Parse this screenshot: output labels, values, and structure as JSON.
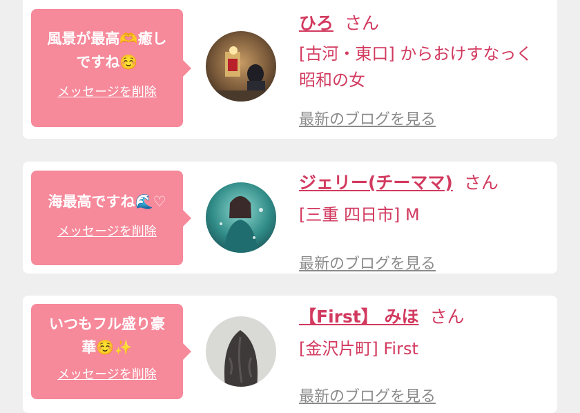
{
  "colors": {
    "bubble_bg": "#f6899a",
    "accent": "#d23a5f",
    "muted_link": "#8a8a8a",
    "page_bg": "#efefef"
  },
  "messages": [
    {
      "message": "風景が最高🫶癒し\nですね☺️",
      "delete_label": "メッセージを削除",
      "avatar": "photo-avatar-sign-and-person",
      "name": "ひろ",
      "honorific": "さん",
      "area": "[古河・東口] からおけすなっく\n昭和の女",
      "blog_link": "最新のブログを見る"
    },
    {
      "message": "海最高ですね🌊♡",
      "delete_label": "メッセージを削除",
      "avatar": "photo-avatar-woman-teal",
      "name": "ジェリー(チーママ)",
      "honorific": "さん",
      "area": "[三重 四日市] M",
      "blog_link": "最新のブログを見る"
    },
    {
      "message": "いつもフル盛り豪\n華☺️✨",
      "delete_label": "メッセージを削除",
      "avatar": "photo-avatar-curly-hair",
      "name": "【First】 みほ",
      "honorific": "さん",
      "area": "[金沢片町] First",
      "blog_link": "最新のブログを見る"
    }
  ]
}
